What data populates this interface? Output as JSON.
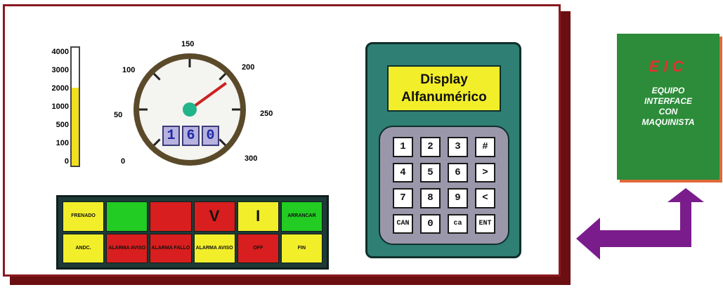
{
  "level_bar": {
    "labels": [
      "4000",
      "3000",
      "2000",
      "1000",
      "500",
      "100",
      "0"
    ],
    "level_fraction": 0.66,
    "fill_color": "#f0e020"
  },
  "gauge": {
    "labels": [
      "0",
      "50",
      "100",
      "150",
      "200",
      "250",
      "300"
    ],
    "needle_value": 210,
    "digits": [
      "1",
      "6",
      "0"
    ]
  },
  "status_grid": {
    "row1": [
      {
        "text": "FRENADO",
        "color": "#f2ee2a"
      },
      {
        "text": "",
        "color": "#22cc22"
      },
      {
        "text": "",
        "color": "#d81e1e"
      },
      {
        "text": "V",
        "color": "#d81e1e"
      },
      {
        "text": "I",
        "color": "#f2ee2a"
      },
      {
        "text": "ARRANCAR",
        "color": "#22cc22"
      }
    ],
    "row2": [
      {
        "text": "ANDC.",
        "color": "#f2ee2a"
      },
      {
        "text": "ALARMA AVISO",
        "color": "#d81e1e"
      },
      {
        "text": "ALARMA FALLO",
        "color": "#d81e1e"
      },
      {
        "text": "ALARMA AVISO",
        "color": "#f2ee2a"
      },
      {
        "text": "OFF",
        "color": "#d81e1e"
      },
      {
        "text": "FIN",
        "color": "#f2ee2a"
      }
    ]
  },
  "display": {
    "line1": "Display",
    "line2": "Alfanumérico"
  },
  "keypad": {
    "keys": [
      "1",
      "2",
      "3",
      "#",
      "4",
      "5",
      "6",
      ">",
      "7",
      "8",
      "9",
      "<",
      "CAN",
      "0",
      "ca",
      "ENT"
    ]
  },
  "eic": {
    "title": "EIC",
    "lines": [
      "EQUIPO",
      "INTERFACE",
      "CON",
      "MAQUINISTA"
    ]
  },
  "colors": {
    "frame": "#8a1a1f",
    "device": "#2f7f74",
    "eic_bg": "#2c8c3a",
    "arrow": "#7a1c8c"
  }
}
